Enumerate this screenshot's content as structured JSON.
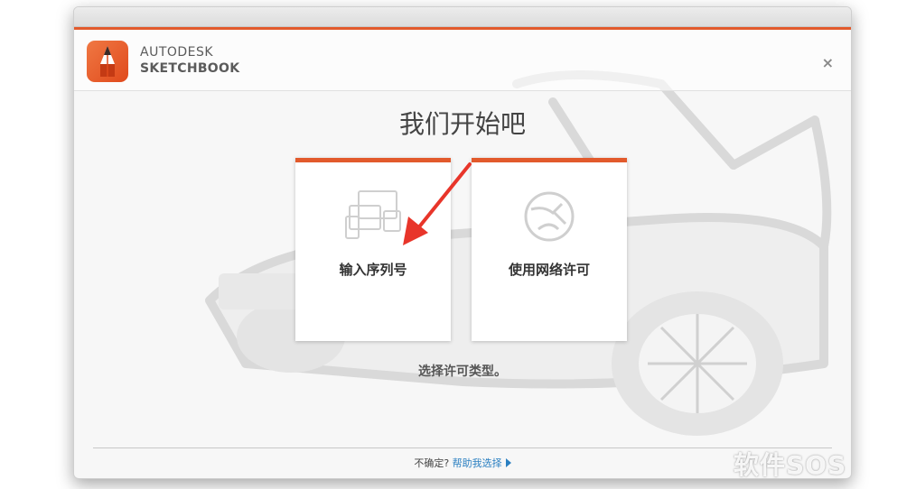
{
  "window": {
    "brand_line1": "AUTODESK",
    "brand_line2": "SKETCHBOOK",
    "close_label": "×",
    "heading": "我们开始吧"
  },
  "options": [
    {
      "label": "输入序列号",
      "icon": "devices-icon"
    },
    {
      "label": "使用网络许可",
      "icon": "globe-icon"
    }
  ],
  "hint": "选择许可类型。",
  "footer": {
    "prefix": "不确定?",
    "link": "帮助我选择"
  },
  "watermark": "软件SOS",
  "colors": {
    "accent": "#e25a2c",
    "link": "#2a7fc1",
    "arrow": "#e8352a"
  }
}
